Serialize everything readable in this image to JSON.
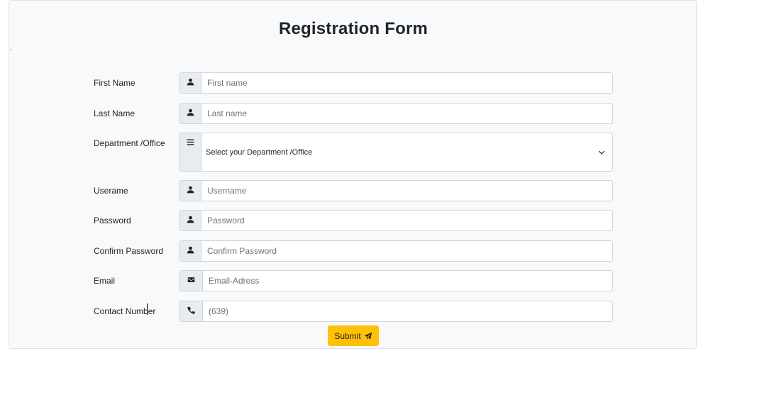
{
  "form": {
    "title": "Registration Form",
    "stray_mark": "`",
    "fields": [
      {
        "label": "First Name",
        "placeholder": "First name",
        "icon": "user-icon"
      },
      {
        "label": "Last Name",
        "placeholder": "Last name",
        "icon": "user-icon"
      },
      {
        "label": "Department /Office",
        "selected": "Select your Department /Office",
        "icon": "list-icon"
      },
      {
        "label": "Userame",
        "placeholder": "Username",
        "icon": "user-icon"
      },
      {
        "label": "Password",
        "placeholder": "Password",
        "icon": "user-icon"
      },
      {
        "label": "Confirm Password",
        "placeholder": "Confirm Password",
        "icon": "user-icon"
      },
      {
        "label": "Email",
        "placeholder": "Email-Adress",
        "icon": "envelope-icon"
      },
      {
        "label": "Contact Number",
        "placeholder": "(639)",
        "icon": "phone-icon"
      }
    ],
    "submit_label": "Submit"
  },
  "colors": {
    "accent": "#ffc107",
    "card_bg": "#f8f9fa",
    "addon_bg": "#e9ecef"
  }
}
